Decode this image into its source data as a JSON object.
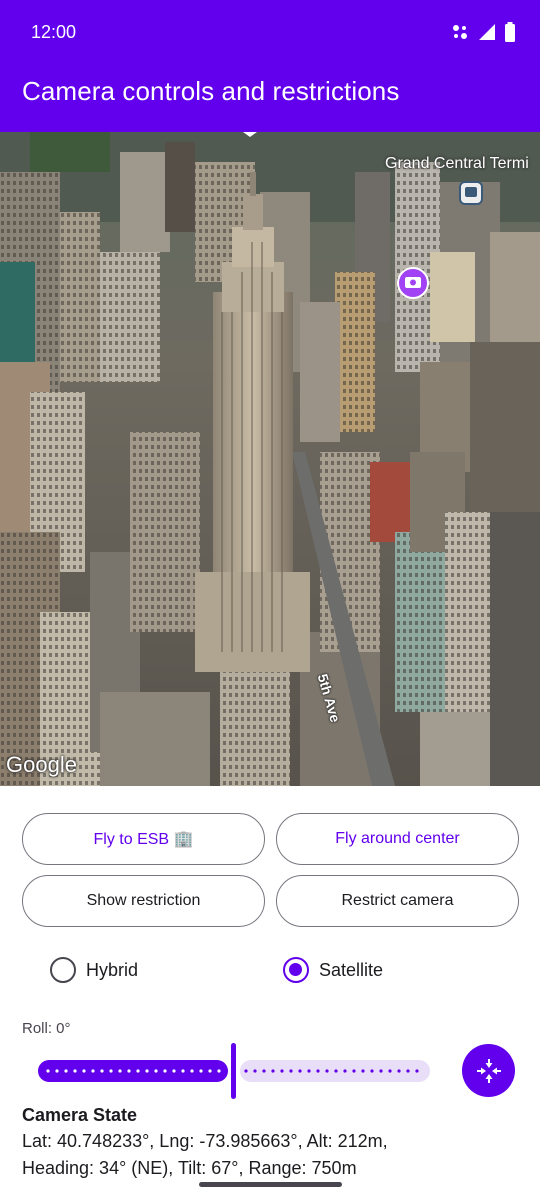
{
  "status_bar": {
    "time": "12:00"
  },
  "app_bar": {
    "title": "Camera controls and restrictions"
  },
  "map": {
    "poi_label": "Grand Central Termi",
    "street_label": "5th Ave",
    "attribution": "Google"
  },
  "buttons": {
    "fly_to_esb": "Fly to ESB 🏢",
    "fly_around_center": "Fly around center",
    "show_restriction": "Show restriction",
    "restrict_camera": "Restrict camera"
  },
  "map_type": {
    "options": [
      {
        "label": "Hybrid",
        "selected": false
      },
      {
        "label": "Satellite",
        "selected": true
      }
    ]
  },
  "roll": {
    "label": "Roll: 0°",
    "value_fraction": 0.5
  },
  "camera_state": {
    "title": "Camera State",
    "line1": "Lat: 40.748233°, Lng: -73.985663°, Alt: 212m,",
    "line2": "Heading: 34° (NE), Tilt: 67°, Range: 750m"
  },
  "colors": {
    "primary": "#6200ee",
    "outline": "#79747e"
  }
}
